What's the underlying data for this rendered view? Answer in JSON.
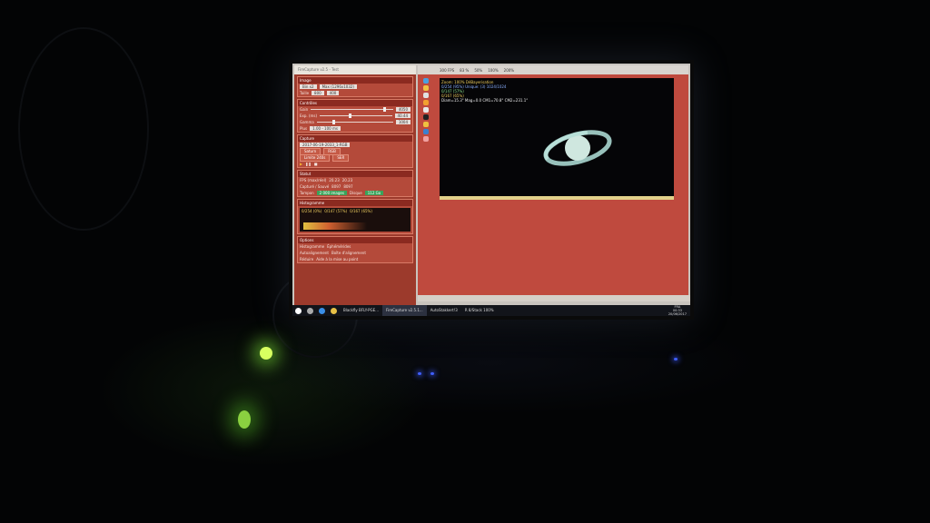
{
  "panel": {
    "title": "FireCapture v2.5 - Test",
    "image": {
      "header": "Image",
      "bin": "Bin x2",
      "max": "Max (1296x1032)",
      "size_label": "Taille",
      "width": "800",
      "height": "400"
    },
    "controls": {
      "header": "Contrôles",
      "gain_label": "Gain",
      "gain_value": "4050",
      "exp_label": "Exp. (ms)",
      "exp_value": "40.44",
      "gamma_label": "Gamma",
      "gamma_value": "1004",
      "plus_label": "Plus",
      "range": "1.00 - 100 ms"
    },
    "capture": {
      "header": "Capture",
      "filename": "2017-06-19-2033_1-RGB",
      "object": "Saturn",
      "color": "RGB",
      "limit": "Limite 240s",
      "format": "SER"
    },
    "status": {
      "header": "Statut",
      "fps_label": "FPS (max/réel)",
      "fps_a": "20.23",
      "fps_b": "20.23",
      "captured_label": "Capturé / Sauvé",
      "cap_a": "8097",
      "cap_b": "8097",
      "buffer_label": "Tampon",
      "buffer_value": "2 000 images",
      "disk_label": "Disque",
      "disk_value": "112 Go"
    },
    "histogram": {
      "header": "Histogramme",
      "a": "0/254 (0%)",
      "b": "0/147 (57%)",
      "c": "0/167 (65%)"
    },
    "options": {
      "header": "Options",
      "o1": "Histogramme",
      "o2": "Éphémérides",
      "o3": "Autoalignement",
      "o4": "Boîte d'alignement",
      "o5": "Réduire",
      "o6": "Aide à la mise au point"
    }
  },
  "toolbar": {
    "fps": "300 FPS",
    "zoom1": "83 %",
    "zoom2": "50%",
    "zoom3": "100%",
    "zoom4": "200%"
  },
  "overlay": {
    "l1": "Zoom: 100%   DéBayerisation",
    "l2": "0/254 (95%)   Unique: (3)   1024/1024",
    "l3": "0/147 (57%)",
    "l4": "0/167 (65%)",
    "l5": "Diam=15.3\"  Mag=0.0   CM1=70.8° CM2=231.1°"
  },
  "taskbar": {
    "t1": "Blackfly BFLY-PGE...",
    "t2": "FireCapture v2.5.1...",
    "t3": "AutoStakkert!3",
    "t4": "R 8/Stack 100%",
    "lang": "FRA",
    "time": "00:33",
    "date": "20/06/2017"
  },
  "colors": {
    "panel": "#9c3a2c",
    "window": "#bf4a3e",
    "planet": "#bfe0da"
  }
}
